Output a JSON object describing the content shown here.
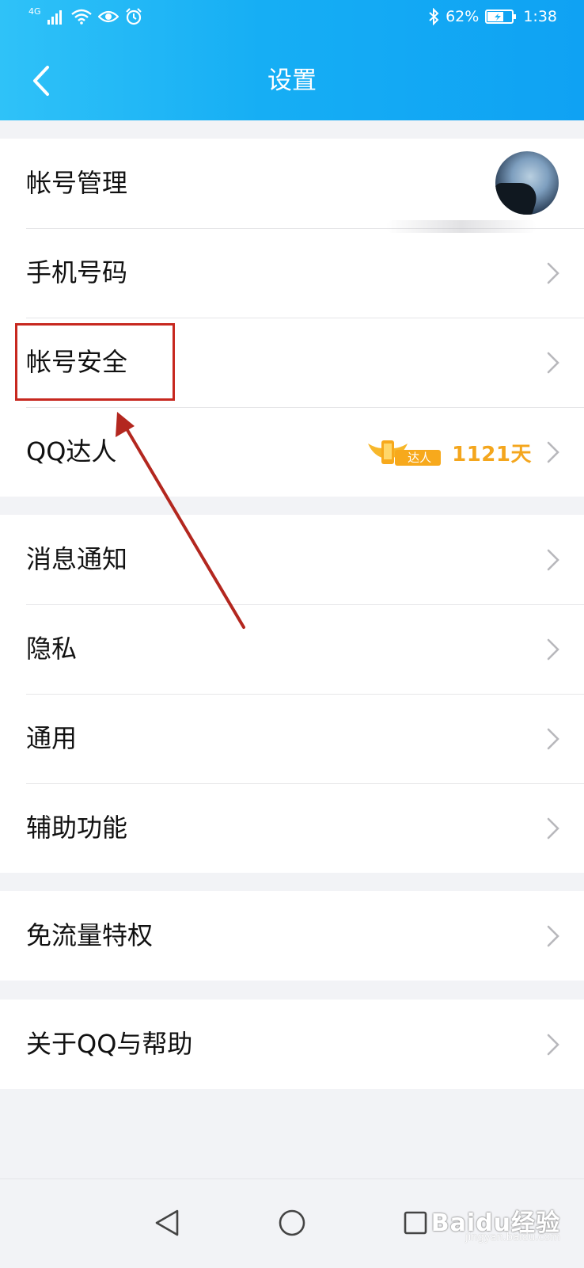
{
  "status_bar": {
    "network": "4G",
    "battery": "62%",
    "time": "1:38"
  },
  "header": {
    "title": "设置"
  },
  "groups": [
    {
      "items": [
        {
          "label": "帐号管理"
        },
        {
          "label": "手机号码"
        },
        {
          "label": "帐号安全"
        },
        {
          "label": "QQ达人",
          "badge_tag": "达人",
          "badge_value": "1121天"
        }
      ]
    },
    {
      "items": [
        {
          "label": "消息通知"
        },
        {
          "label": "隐私"
        },
        {
          "label": "通用"
        },
        {
          "label": "辅助功能"
        }
      ]
    },
    {
      "items": [
        {
          "label": "免流量特权"
        }
      ]
    },
    {
      "items": [
        {
          "label": "关于QQ与帮助"
        }
      ]
    }
  ],
  "watermark": {
    "brand": "Baidu经验",
    "url": "jingyan.baidu.com"
  },
  "colors": {
    "header_start": "#2fc2f8",
    "header_end": "#0fa2f3",
    "highlight_red": "#c7281f",
    "badge_gold": "#f4a61d"
  }
}
